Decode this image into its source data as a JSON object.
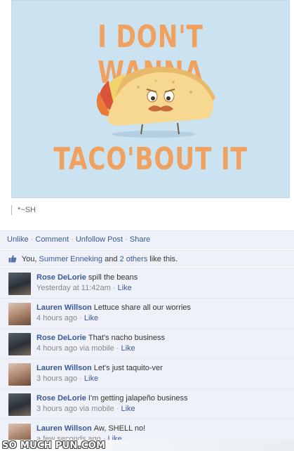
{
  "post": {
    "image_text_top": "I DON'T WANNA",
    "image_text_bottom": "TACO'BOUT IT",
    "caption": "*~SH"
  },
  "actions": {
    "unlike": "Unlike",
    "comment": "Comment",
    "unfollow": "Unfollow Post",
    "share": "Share",
    "separator": "·"
  },
  "likes": {
    "you": "You,",
    "person": "Summer Enneking",
    "and": "and",
    "others": "2 others",
    "suffix": "like this."
  },
  "comments": [
    {
      "author": "Rose DeLorie",
      "text": "spill the beans",
      "time": "Yesterday at 11:42am",
      "via": "",
      "like": "Like",
      "avatar": "rose"
    },
    {
      "author": "Lauren Willson",
      "text": "Lettuce share all our worries",
      "time": "4 hours ago",
      "via": "",
      "like": "Like",
      "avatar": "lauren"
    },
    {
      "author": "Rose DeLorie",
      "text": "That's nacho business",
      "time": "4 hours ago",
      "via": "via mobile",
      "like": "Like",
      "avatar": "rose"
    },
    {
      "author": "Lauren Willson",
      "text": "Let's just taquito-ver",
      "time": "3 hours ago",
      "via": "",
      "like": "Like",
      "avatar": "lauren"
    },
    {
      "author": "Rose DeLorie",
      "text": "I'm getting jalapeño business",
      "time": "3 hours ago",
      "via": "via mobile",
      "like": "Like",
      "avatar": "rose"
    },
    {
      "author": "Lauren Willson",
      "text": "Aw, SHELL no!",
      "time": "a few seconds ago",
      "via": "",
      "like": "Like",
      "avatar": "lauren"
    }
  ],
  "watermark": "SO MUCH PUN.COM",
  "colors": {
    "link": "#3b5998",
    "image_bg": "#cbe3f1",
    "text_orange": "#f0a15f",
    "comment_bg": "#eef1f7"
  }
}
